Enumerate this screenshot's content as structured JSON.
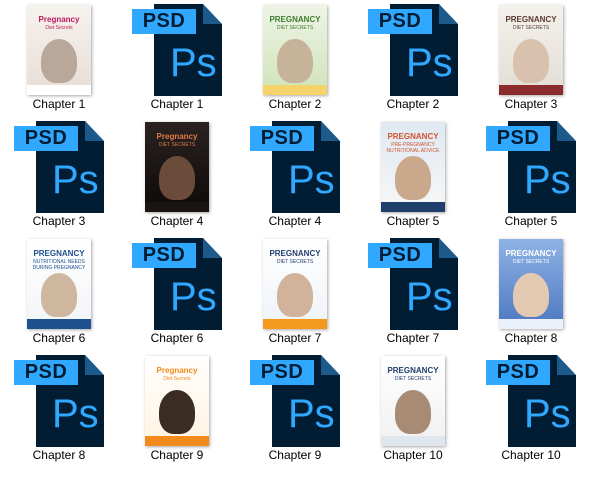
{
  "colors": {
    "psd_page": "#001d34",
    "psd_accent": "#31a8ff",
    "label_text": "#000000",
    "background": "#ffffff"
  },
  "psd_icon": {
    "tag": "PSD",
    "mark": "Ps"
  },
  "files": [
    {
      "label": "Chapter 1",
      "kind": "cover",
      "icon": "book-cover-image",
      "title": "Pregnancy",
      "subtitle": "Diet Secrets",
      "style": "c1"
    },
    {
      "label": "Chapter 1",
      "kind": "psd",
      "icon": "photoshop-file-icon"
    },
    {
      "label": "Chapter 2",
      "kind": "cover",
      "icon": "book-cover-image",
      "title": "PREGNANCY",
      "subtitle": "DIET SECRETS",
      "style": "c2"
    },
    {
      "label": "Chapter 2",
      "kind": "psd",
      "icon": "photoshop-file-icon"
    },
    {
      "label": "Chapter 3",
      "kind": "cover",
      "icon": "book-cover-image",
      "title": "PREGNANCY",
      "subtitle": "DIET SECRETS",
      "style": "c3"
    },
    {
      "label": "Chapter 3",
      "kind": "psd",
      "icon": "photoshop-file-icon"
    },
    {
      "label": "Chapter 4",
      "kind": "cover",
      "icon": "book-cover-image",
      "title": "Pregnancy",
      "subtitle": "DIET SECRETS",
      "style": "c4"
    },
    {
      "label": "Chapter 4",
      "kind": "psd",
      "icon": "photoshop-file-icon"
    },
    {
      "label": "Chapter 5",
      "kind": "cover",
      "icon": "book-cover-image",
      "title": "PREGNANCY",
      "subtitle": "PRE-PREGNANCY NUTRITIONAL ADVICE",
      "style": "c5"
    },
    {
      "label": "Chapter 5",
      "kind": "psd",
      "icon": "photoshop-file-icon"
    },
    {
      "label": "Chapter 6",
      "kind": "cover",
      "icon": "book-cover-image",
      "title": "PREGNANCY",
      "subtitle": "NUTRITIONAL NEEDS DURING PREGNANCY",
      "style": "c6"
    },
    {
      "label": "Chapter 6",
      "kind": "psd",
      "icon": "photoshop-file-icon"
    },
    {
      "label": "Chapter 7",
      "kind": "cover",
      "icon": "book-cover-image",
      "title": "PREGNANCY",
      "subtitle": "DIET SECRETS",
      "style": "c7"
    },
    {
      "label": "Chapter 7",
      "kind": "psd",
      "icon": "photoshop-file-icon"
    },
    {
      "label": "Chapter 8",
      "kind": "cover",
      "icon": "book-cover-image",
      "title": "PREGNANCY",
      "subtitle": "DIET SECRETS",
      "style": "c8"
    },
    {
      "label": "Chapter 8",
      "kind": "psd",
      "icon": "photoshop-file-icon"
    },
    {
      "label": "Chapter 9",
      "kind": "cover",
      "icon": "book-cover-image",
      "title": "Pregnancy",
      "subtitle": "Diet Secrets",
      "style": "c9"
    },
    {
      "label": "Chapter 9",
      "kind": "psd",
      "icon": "photoshop-file-icon"
    },
    {
      "label": "Chapter 10",
      "kind": "cover",
      "icon": "book-cover-image",
      "title": "PREGNANCY",
      "subtitle": "DIET SECRETS",
      "style": "c10"
    },
    {
      "label": "Chapter 10",
      "kind": "psd",
      "icon": "photoshop-file-icon"
    }
  ]
}
